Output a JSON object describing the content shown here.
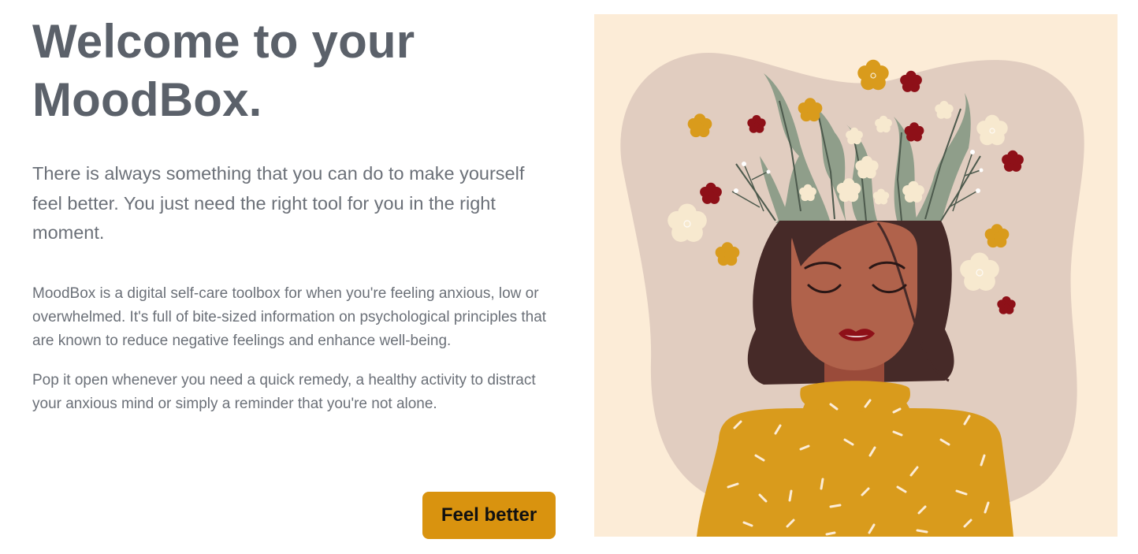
{
  "hero": {
    "title_line1": "Welcome to your",
    "title_line2": "MoodBox.",
    "lead": "There is always something that you can do to make yourself feel better. You just need the right tool for you in the right moment.",
    "paragraph1": "MoodBox is a digital self-care toolbox for when you're feeling anxious, low or overwhelmed. It's full of bite-sized information on psychological principles that are known to reduce negative feelings and enhance well-being.",
    "paragraph2": "Pop it open whenever you need a quick remedy, a healthy activity to distract your anxious mind or simply a reminder that you're not alone.",
    "cta_label": "Feel better"
  },
  "colors": {
    "heading": "#5b616a",
    "text": "#6b7078",
    "cta_bg": "#d9930f",
    "illustration_bg": "#fcecd7",
    "blob": "#e1cdc0",
    "skin": "#b0624b",
    "hair": "#462a28",
    "sweater": "#d99b1c",
    "leaf": "#8f9e8a",
    "flower_gold": "#d99b1c",
    "flower_red": "#8e1018",
    "flower_cream": "#f7e9cf"
  },
  "illustration": {
    "icon": "woman-with-flowers-illustration"
  }
}
